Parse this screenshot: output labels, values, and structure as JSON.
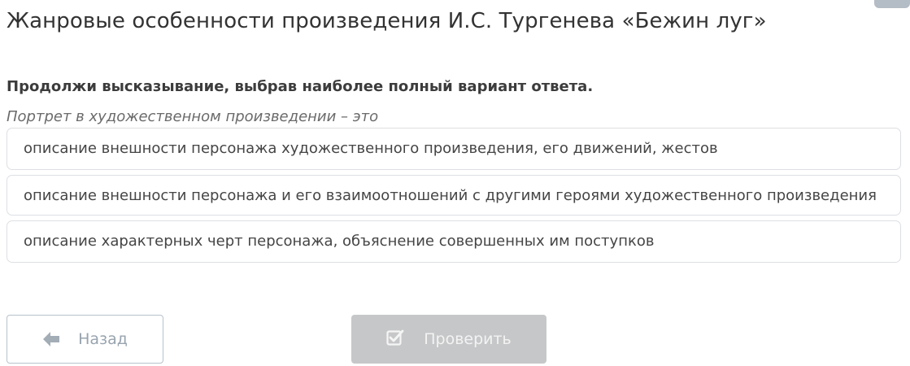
{
  "page": {
    "title": "Жанровые особенности произведения И.С. Тургенева «Бежин луг»"
  },
  "task": {
    "instruction": "Продолжи высказывание, выбрав наиболее полный вариант ответа.",
    "question": "Портрет в художественном произведении – это"
  },
  "options": [
    {
      "label": "описание внешности персонажа художественного произведения, его движений, жестов"
    },
    {
      "label": "описание внешности персонажа и его взаимоотношений с другими героями художественного произведения"
    },
    {
      "label": "описание характерных черт персонажа, объяснение совершенных им поступков"
    }
  ],
  "buttons": {
    "back": {
      "label": "Назад",
      "icon": "arrow-left-icon"
    },
    "check": {
      "label": "Проверить",
      "icon": "checkbox-checked-icon",
      "disabled": true
    }
  },
  "colors": {
    "option_border": "#dcdfe3",
    "back_text": "#98a4ae",
    "check_bg": "#c6c7c8"
  }
}
